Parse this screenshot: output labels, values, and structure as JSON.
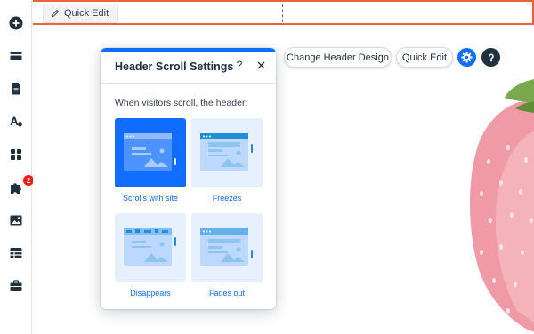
{
  "sidebar": {
    "tools": [
      {
        "name": "add-elements",
        "icon": "plus-circle-icon"
      },
      {
        "name": "sections",
        "icon": "sections-icon"
      },
      {
        "name": "pages",
        "icon": "page-icon"
      },
      {
        "name": "site-design",
        "icon": "theme-icon"
      },
      {
        "name": "add-apps",
        "icon": "apps-grid-icon"
      },
      {
        "name": "my-business",
        "icon": "puzzle-icon",
        "badge": "2"
      },
      {
        "name": "media",
        "icon": "image-icon"
      },
      {
        "name": "cms",
        "icon": "table-icon"
      },
      {
        "name": "portfolio",
        "icon": "briefcase-icon"
      }
    ]
  },
  "canvas": {
    "header_quick_edit_label": "Quick Edit",
    "toolbar": {
      "change_header_design_label": "Change Header Design",
      "quick_edit_label": "Quick Edit"
    }
  },
  "panel": {
    "title": "Header Scroll Settings",
    "help": "?",
    "subtitle": "When visitors scroll, the header:",
    "options": [
      {
        "label": "Scrolls with site",
        "selected": true
      },
      {
        "label": "Freezes",
        "selected": false
      },
      {
        "label": "Disappears",
        "selected": false
      },
      {
        "label": "Fades out",
        "selected": false
      }
    ]
  },
  "colors": {
    "accent": "#116dff",
    "header_outline": "#e8643a",
    "tile_bg": "#e7f0ff",
    "badge": "#e62214"
  }
}
